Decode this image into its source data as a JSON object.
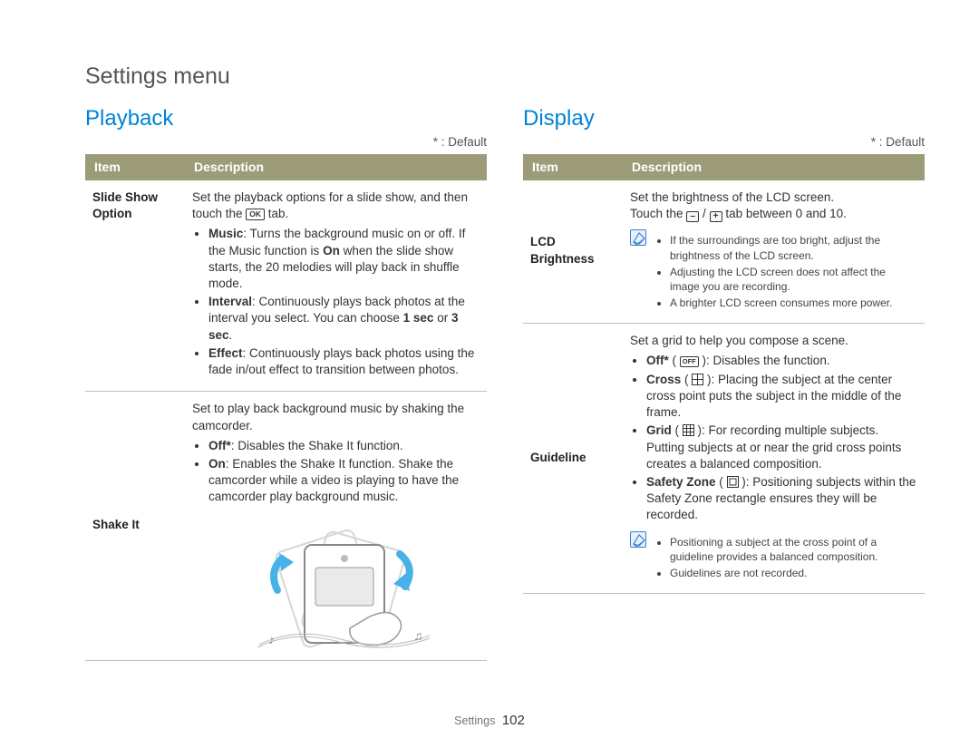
{
  "page_title": "Settings menu",
  "default_note": "* : Default",
  "table_headers": {
    "item": "Item",
    "description": "Description"
  },
  "footer": {
    "section": "Settings",
    "page": "102"
  },
  "playback": {
    "heading": "Playback",
    "rows": {
      "slideshow": {
        "item": "Slide Show Option",
        "intro_a": "Set the playback options for a slide show, and then touch the ",
        "intro_b": " tab.",
        "ok_label": "OK",
        "music_label": "Music",
        "music_text": ": Turns the background music on or off. If the Music function is ",
        "music_on": "On",
        "music_suffix": " when the slide show starts, the 20 melodies will play back in shuffle mode.",
        "interval_label": "Interval",
        "interval_text": ": Continuously plays back photos at the interval you select. You can choose ",
        "interval_1s": "1 sec",
        "interval_or": " or ",
        "interval_3s": "3 sec",
        "interval_period": ".",
        "effect_label": "Effect",
        "effect_text": ": Continuously plays back photos using the fade in/out effect to transition between photos."
      },
      "shakeit": {
        "item": "Shake It",
        "intro": "Set to play back background music by shaking the camcorder.",
        "off_label": "Off*",
        "off_text": ": Disables the Shake It function.",
        "on_label": "On",
        "on_text": ": Enables the Shake It function. Shake the camcorder while a video is playing to have the camcorder play background music."
      }
    }
  },
  "display": {
    "heading": "Display",
    "rows": {
      "lcd": {
        "item": "LCD Brightness",
        "line1": "Set the brightness of the LCD screen.",
        "line2a": "Touch the ",
        "minus": "–",
        "slash": " / ",
        "plus": "+",
        "line2b": " tab between 0 and 10.",
        "notes": [
          "If the surroundings are too bright, adjust the brightness of the LCD screen.",
          "Adjusting the LCD screen does not affect the image you are recording.",
          "A brighter LCD screen consumes more power."
        ]
      },
      "guideline": {
        "item": "Guideline",
        "intro": "Set a grid to help you compose a scene.",
        "off_label": "Off*",
        "off_icon": "OFF",
        "off_text": ": Disables the function.",
        "cross_label": "Cross",
        "cross_text": ": Placing the subject at the center cross point puts the subject in the middle of the frame.",
        "grid_label": "Grid",
        "grid_text": ": For recording multiple subjects. Putting subjects at or near the grid cross points creates a balanced composition.",
        "sz_label": "Safety Zone",
        "sz_text": ": Positioning subjects within the Safety Zone rectangle ensures they will be recorded.",
        "notes": [
          "Positioning a subject at the cross point of a guideline provides a balanced composition.",
          "Guidelines are not recorded."
        ]
      }
    }
  }
}
